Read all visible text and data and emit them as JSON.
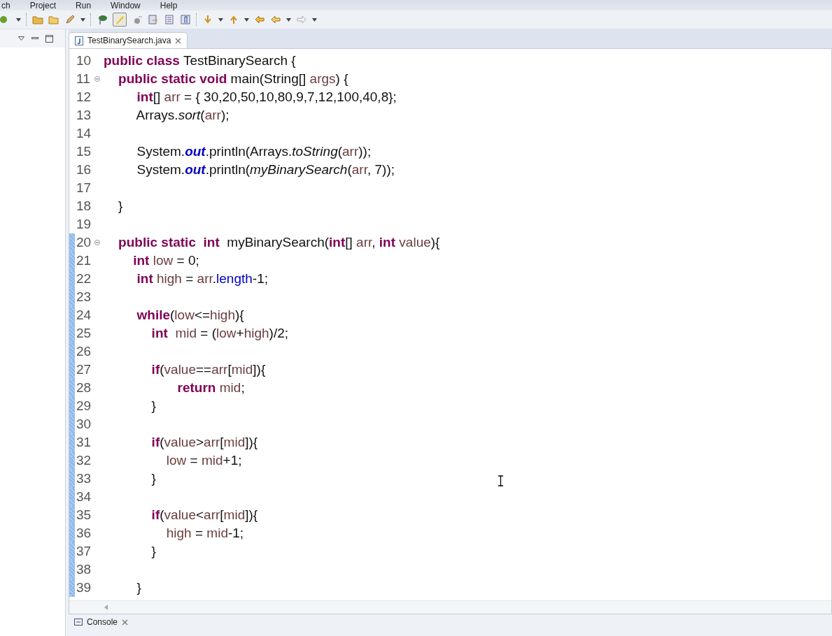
{
  "menu": [
    "ch",
    "Project",
    "Run",
    "Window",
    "Help"
  ],
  "editor_tab": {
    "title": "TestBinarySearch.java",
    "selected": true
  },
  "code_lines": [
    {
      "number": "10",
      "fold": false,
      "changed": false,
      "tokens": [
        {
          "t": "public class ",
          "kind": "kw"
        },
        {
          "t": "TestBinarySearch {",
          "kind": "plain"
        }
      ]
    },
    {
      "number": "11",
      "fold": true,
      "changed": false,
      "tokens": [
        {
          "t": "    public static void ",
          "kind": "kw"
        },
        {
          "t": "main(String[] ",
          "kind": "plain"
        },
        {
          "t": "args",
          "kind": "var"
        },
        {
          "t": ") {",
          "kind": "plain"
        }
      ]
    },
    {
      "number": "12",
      "fold": false,
      "changed": false,
      "tokens": [
        {
          "t": "         int",
          "kind": "kw"
        },
        {
          "t": "[] ",
          "kind": "plain"
        },
        {
          "t": "arr",
          "kind": "var"
        },
        {
          "t": " = { 30,20,50,10,80,9,7,12,100,40,8};",
          "kind": "plain"
        }
      ]
    },
    {
      "number": "13",
      "fold": false,
      "changed": false,
      "tokens": [
        {
          "t": "         Arrays.",
          "kind": "plain"
        },
        {
          "t": "sort",
          "kind": "static"
        },
        {
          "t": "(",
          "kind": "plain"
        },
        {
          "t": "arr",
          "kind": "var"
        },
        {
          "t": ");",
          "kind": "plain"
        }
      ]
    },
    {
      "number": "14",
      "fold": false,
      "changed": false
    },
    {
      "number": "15",
      "fold": false,
      "changed": false,
      "tokens": [
        {
          "t": "         System.",
          "kind": "plain"
        },
        {
          "t": "out",
          "kind": "field"
        },
        {
          "t": ".println(Arrays.",
          "kind": "plain"
        },
        {
          "t": "toString",
          "kind": "static"
        },
        {
          "t": "(",
          "kind": "plain"
        },
        {
          "t": "arr",
          "kind": "var"
        },
        {
          "t": "));",
          "kind": "plain"
        }
      ]
    },
    {
      "number": "16",
      "fold": false,
      "changed": false,
      "tokens": [
        {
          "t": "         System.",
          "kind": "plain"
        },
        {
          "t": "out",
          "kind": "field"
        },
        {
          "t": ".println(",
          "kind": "plain"
        },
        {
          "t": "myBinarySearch",
          "kind": "static"
        },
        {
          "t": "(",
          "kind": "plain"
        },
        {
          "t": "arr",
          "kind": "var"
        },
        {
          "t": ", 7));",
          "kind": "plain"
        }
      ]
    },
    {
      "number": "17",
      "fold": false,
      "changed": false
    },
    {
      "number": "18",
      "fold": false,
      "changed": false,
      "tokens": [
        {
          "t": "    }",
          "kind": "plain"
        }
      ]
    },
    {
      "number": "19",
      "fold": false,
      "changed": false
    },
    {
      "number": "20",
      "fold": true,
      "changed": true,
      "tokens": [
        {
          "t": "    public static  int  ",
          "kind": "kw"
        },
        {
          "t": "myBinarySearch(",
          "kind": "plain"
        },
        {
          "t": "int",
          "kind": "kw"
        },
        {
          "t": "[] ",
          "kind": "plain"
        },
        {
          "t": "arr",
          "kind": "var"
        },
        {
          "t": ", ",
          "kind": "plain"
        },
        {
          "t": "int ",
          "kind": "kw"
        },
        {
          "t": "value",
          "kind": "var"
        },
        {
          "t": "){",
          "kind": "plain"
        }
      ]
    },
    {
      "number": "21",
      "fold": false,
      "changed": true,
      "tokens": [
        {
          "t": "        int ",
          "kind": "kw"
        },
        {
          "t": "low",
          "kind": "var"
        },
        {
          "t": " = 0;",
          "kind": "plain"
        }
      ]
    },
    {
      "number": "22",
      "fold": false,
      "changed": true,
      "tokens": [
        {
          "t": "         int ",
          "kind": "kw"
        },
        {
          "t": "high",
          "kind": "var"
        },
        {
          "t": " = ",
          "kind": "plain"
        },
        {
          "t": "arr",
          "kind": "var"
        },
        {
          "t": ".",
          "kind": "plain"
        },
        {
          "t": "length",
          "kind": "member"
        },
        {
          "t": "-1;",
          "kind": "plain"
        }
      ]
    },
    {
      "number": "23",
      "fold": false,
      "changed": true
    },
    {
      "number": "24",
      "fold": false,
      "changed": true,
      "tokens": [
        {
          "t": "         while",
          "kind": "kw"
        },
        {
          "t": "(",
          "kind": "plain"
        },
        {
          "t": "low",
          "kind": "var"
        },
        {
          "t": "<=",
          "kind": "plain"
        },
        {
          "t": "high",
          "kind": "var"
        },
        {
          "t": "){",
          "kind": "plain"
        }
      ]
    },
    {
      "number": "25",
      "fold": false,
      "changed": true,
      "tokens": [
        {
          "t": "             int  ",
          "kind": "kw"
        },
        {
          "t": "mid",
          "kind": "var"
        },
        {
          "t": " = (",
          "kind": "plain"
        },
        {
          "t": "low",
          "kind": "var"
        },
        {
          "t": "+",
          "kind": "plain"
        },
        {
          "t": "high",
          "kind": "var"
        },
        {
          "t": ")/2;",
          "kind": "plain"
        }
      ]
    },
    {
      "number": "26",
      "fold": false,
      "changed": true
    },
    {
      "number": "27",
      "fold": false,
      "changed": true,
      "tokens": [
        {
          "t": "             if",
          "kind": "kw"
        },
        {
          "t": "(",
          "kind": "plain"
        },
        {
          "t": "value",
          "kind": "var"
        },
        {
          "t": "==",
          "kind": "plain"
        },
        {
          "t": "arr",
          "kind": "var"
        },
        {
          "t": "[",
          "kind": "plain"
        },
        {
          "t": "mid",
          "kind": "var"
        },
        {
          "t": "]){",
          "kind": "plain"
        }
      ]
    },
    {
      "number": "28",
      "fold": false,
      "changed": true,
      "tokens": [
        {
          "t": "                    return ",
          "kind": "kw"
        },
        {
          "t": "mid",
          "kind": "var"
        },
        {
          "t": ";",
          "kind": "plain"
        }
      ]
    },
    {
      "number": "29",
      "fold": false,
      "changed": true,
      "tokens": [
        {
          "t": "             }",
          "kind": "plain"
        }
      ]
    },
    {
      "number": "30",
      "fold": false,
      "changed": true
    },
    {
      "number": "31",
      "fold": false,
      "changed": true,
      "tokens": [
        {
          "t": "             if",
          "kind": "kw"
        },
        {
          "t": "(",
          "kind": "plain"
        },
        {
          "t": "value",
          "kind": "var"
        },
        {
          "t": ">",
          "kind": "plain"
        },
        {
          "t": "arr",
          "kind": "var"
        },
        {
          "t": "[",
          "kind": "plain"
        },
        {
          "t": "mid",
          "kind": "var"
        },
        {
          "t": "]){",
          "kind": "plain"
        }
      ]
    },
    {
      "number": "32",
      "fold": false,
      "changed": true,
      "tokens": [
        {
          "t": "                 low",
          "kind": "var"
        },
        {
          "t": " = ",
          "kind": "plain"
        },
        {
          "t": "mid",
          "kind": "var"
        },
        {
          "t": "+1;",
          "kind": "plain"
        }
      ]
    },
    {
      "number": "33",
      "fold": false,
      "changed": true,
      "tokens": [
        {
          "t": "             }",
          "kind": "plain"
        }
      ]
    },
    {
      "number": "34",
      "fold": false,
      "changed": true
    },
    {
      "number": "35",
      "fold": false,
      "changed": true,
      "tokens": [
        {
          "t": "             if",
          "kind": "kw"
        },
        {
          "t": "(",
          "kind": "plain"
        },
        {
          "t": "value",
          "kind": "var"
        },
        {
          "t": "<",
          "kind": "plain"
        },
        {
          "t": "arr",
          "kind": "var"
        },
        {
          "t": "[",
          "kind": "plain"
        },
        {
          "t": "mid",
          "kind": "var"
        },
        {
          "t": "]){",
          "kind": "plain"
        }
      ]
    },
    {
      "number": "36",
      "fold": false,
      "changed": true,
      "tokens": [
        {
          "t": "                 high",
          "kind": "var"
        },
        {
          "t": " = ",
          "kind": "plain"
        },
        {
          "t": "mid",
          "kind": "var"
        },
        {
          "t": "-1;",
          "kind": "plain"
        }
      ]
    },
    {
      "number": "37",
      "fold": false,
      "changed": true,
      "tokens": [
        {
          "t": "             }",
          "kind": "plain"
        }
      ]
    },
    {
      "number": "38",
      "fold": false,
      "changed": true
    },
    {
      "number": "39",
      "fold": false,
      "changed": true,
      "tokens": [
        {
          "t": "         }",
          "kind": "plain"
        }
      ]
    }
  ],
  "bottom_tab": {
    "title": "Console",
    "selected": false
  }
}
